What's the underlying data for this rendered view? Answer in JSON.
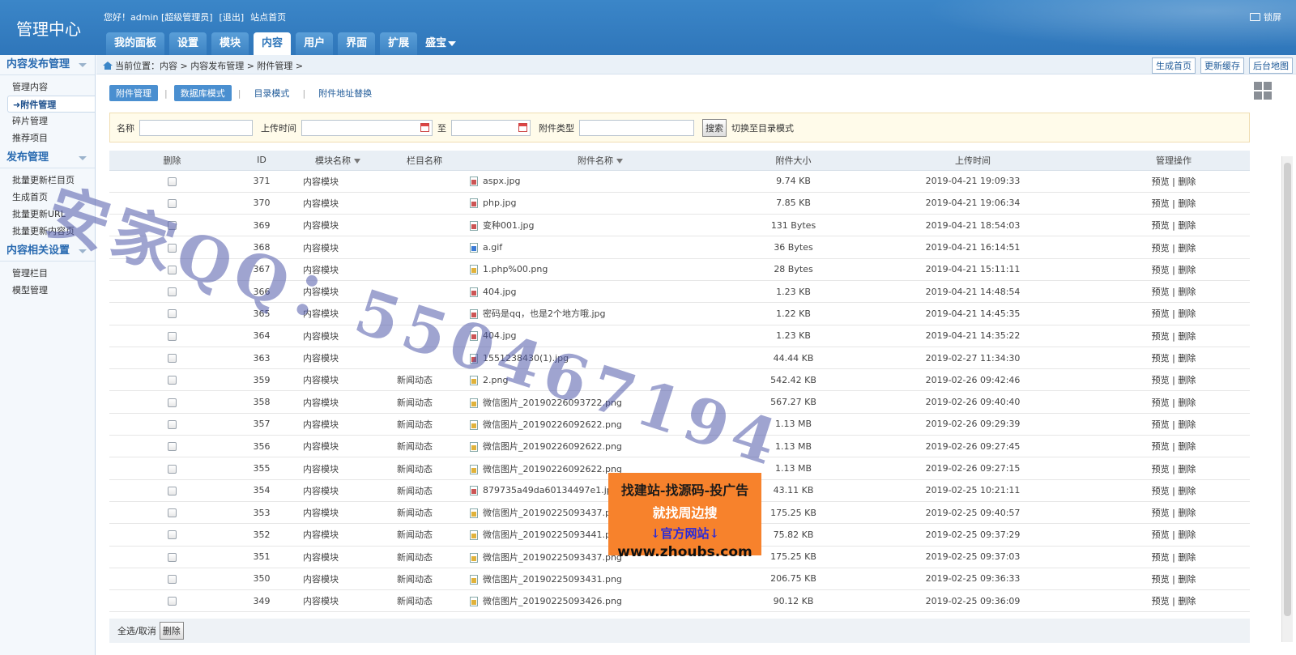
{
  "header": {
    "brand": "管理中心",
    "greeting": "您好！admin [超级管理员]",
    "logout": "[退出]",
    "site_home": "站点首页",
    "lock": "锁屏",
    "tabs": [
      "我的面板",
      "设置",
      "模块",
      "内容",
      "用户",
      "界面",
      "扩展"
    ],
    "active_tab": "内容",
    "extra_tab": "盛宝"
  },
  "sidebar": {
    "sections": [
      {
        "title": "内容发布管理",
        "items": [
          "管理内容",
          "附件管理",
          "碎片管理",
          "推荐项目"
        ],
        "active": "附件管理"
      },
      {
        "title": "发布管理",
        "items": [
          "批量更新栏目页",
          "生成首页",
          "批量更新URL",
          "批量更新内容页"
        ]
      },
      {
        "title": "内容相关设置",
        "items": [
          "管理栏目",
          "模型管理"
        ]
      }
    ]
  },
  "breadcrumb": {
    "text": "当前位置：内容 > 内容发布管理 > 附件管理 >",
    "quick": [
      "生成首页",
      "更新缓存",
      "后台地图"
    ]
  },
  "subtabs": [
    "附件管理",
    "数据库模式",
    "目录模式",
    "附件地址替换"
  ],
  "filter": {
    "name_label": "名称",
    "upload_label": "上传时间",
    "to_label": "至",
    "type_label": "附件类型",
    "search_btn": "搜索",
    "switch_text": "切换至目录模式"
  },
  "table": {
    "headers": [
      "删除",
      "ID",
      "模块名称",
      "栏目名称",
      "附件名称",
      "附件大小",
      "上传时间",
      "管理操作"
    ],
    "rows": [
      {
        "id": "371",
        "module": "内容模块",
        "column": "",
        "file": "aspx.jpg",
        "type": "jpg",
        "size": "9.74 KB",
        "time": "2019-04-21 19:09:33"
      },
      {
        "id": "370",
        "module": "内容模块",
        "column": "",
        "file": "php.jpg",
        "type": "jpg",
        "size": "7.85 KB",
        "time": "2019-04-21 19:06:34"
      },
      {
        "id": "369",
        "module": "内容模块",
        "column": "",
        "file": "变种001.jpg",
        "type": "jpg",
        "size": "131 Bytes",
        "time": "2019-04-21 18:54:03"
      },
      {
        "id": "368",
        "module": "内容模块",
        "column": "",
        "file": "a.gif",
        "type": "gif",
        "size": "36 Bytes",
        "time": "2019-04-21 16:14:51"
      },
      {
        "id": "367",
        "module": "内容模块",
        "column": "",
        "file": "1.php%00.png",
        "type": "png",
        "size": "28 Bytes",
        "time": "2019-04-21 15:11:11"
      },
      {
        "id": "366",
        "module": "内容模块",
        "column": "",
        "file": "404.jpg",
        "type": "jpg",
        "size": "1.23 KB",
        "time": "2019-04-21 14:48:54"
      },
      {
        "id": "365",
        "module": "内容模块",
        "column": "",
        "file": "密码是qq，也是2个地方哦.jpg",
        "type": "jpg",
        "size": "1.22 KB",
        "time": "2019-04-21 14:45:35"
      },
      {
        "id": "364",
        "module": "内容模块",
        "column": "",
        "file": "404.jpg",
        "type": "jpg",
        "size": "1.23 KB",
        "time": "2019-04-21 14:35:22"
      },
      {
        "id": "363",
        "module": "内容模块",
        "column": "",
        "file": "1551238430(1).jpg",
        "type": "jpg",
        "size": "44.44 KB",
        "time": "2019-02-27 11:34:30"
      },
      {
        "id": "359",
        "module": "内容模块",
        "column": "新闻动态",
        "file": "2.png",
        "type": "png",
        "size": "542.42 KB",
        "time": "2019-02-26 09:42:46"
      },
      {
        "id": "358",
        "module": "内容模块",
        "column": "新闻动态",
        "file": "微信图片_20190226093722.png",
        "type": "png",
        "size": "567.27 KB",
        "time": "2019-02-26 09:40:40"
      },
      {
        "id": "357",
        "module": "内容模块",
        "column": "新闻动态",
        "file": "微信图片_20190226092622.png",
        "type": "png",
        "size": "1.13 MB",
        "time": "2019-02-26 09:29:39"
      },
      {
        "id": "356",
        "module": "内容模块",
        "column": "新闻动态",
        "file": "微信图片_20190226092622.png",
        "type": "png",
        "size": "1.13 MB",
        "time": "2019-02-26 09:27:45"
      },
      {
        "id": "355",
        "module": "内容模块",
        "column": "新闻动态",
        "file": "微信图片_20190226092622.png",
        "type": "png",
        "size": "1.13 MB",
        "time": "2019-02-26 09:27:15"
      },
      {
        "id": "354",
        "module": "内容模块",
        "column": "新闻动态",
        "file": "879735a49da60134497e1.jpg",
        "type": "jpg",
        "size": "43.11 KB",
        "time": "2019-02-25 10:21:11"
      },
      {
        "id": "353",
        "module": "内容模块",
        "column": "新闻动态",
        "file": "微信图片_20190225093437.png",
        "type": "png",
        "size": "175.25 KB",
        "time": "2019-02-25 09:40:57"
      },
      {
        "id": "352",
        "module": "内容模块",
        "column": "新闻动态",
        "file": "微信图片_20190225093441.png",
        "type": "png",
        "size": "75.82 KB",
        "time": "2019-02-25 09:37:29"
      },
      {
        "id": "351",
        "module": "内容模块",
        "column": "新闻动态",
        "file": "微信图片_20190225093437.png",
        "type": "png",
        "size": "175.25 KB",
        "time": "2019-02-25 09:37:03"
      },
      {
        "id": "350",
        "module": "内容模块",
        "column": "新闻动态",
        "file": "微信图片_20190225093431.png",
        "type": "png",
        "size": "206.75 KB",
        "time": "2019-02-25 09:36:33"
      },
      {
        "id": "349",
        "module": "内容模块",
        "column": "新闻动态",
        "file": "微信图片_20190225093426.png",
        "type": "png",
        "size": "90.12 KB",
        "time": "2019-02-25 09:36:09"
      }
    ],
    "op_preview": "预览",
    "op_sep": "|",
    "op_delete": "删除"
  },
  "footer": {
    "select_all": "全选/取消",
    "delete_btn": "删除"
  },
  "watermark": {
    "qq_text": "安家QQ：550467194"
  },
  "ad": {
    "line1": "找建站-找源码-投广告",
    "line2": "就找周边搜",
    "line3": "↓官方网站↓",
    "line4": "www.zhoubs.com"
  }
}
